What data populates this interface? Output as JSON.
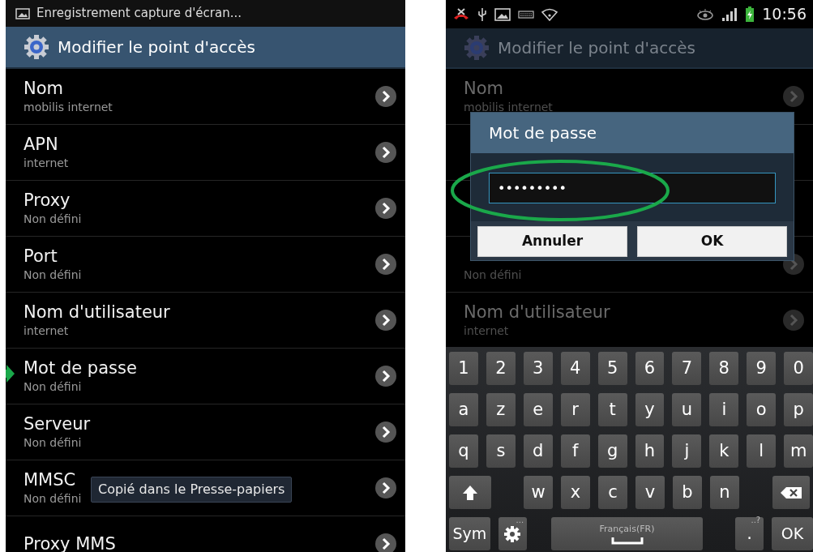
{
  "left_screen": {
    "notification": {
      "text": "Enregistrement capture d'écran..."
    },
    "title": "Modifier le point d'accès",
    "rows": [
      {
        "title": "Nom",
        "subtitle": "mobilis internet"
      },
      {
        "title": "APN",
        "subtitle": "internet"
      },
      {
        "title": "Proxy",
        "subtitle": "Non défini"
      },
      {
        "title": "Port",
        "subtitle": "Non défini"
      },
      {
        "title": "Nom d'utilisateur",
        "subtitle": "internet"
      },
      {
        "title": "Mot de passe",
        "subtitle": "Non défini"
      },
      {
        "title": "Serveur",
        "subtitle": "Non défini"
      },
      {
        "title": "MMSC",
        "subtitle": "Non défini"
      },
      {
        "title": "Proxy MMS"
      }
    ],
    "toast": "Copié dans le Presse-papiers"
  },
  "right_screen": {
    "status_bar": {
      "time": "10:56"
    },
    "title": "Modifier le point d'accès",
    "rows": [
      {
        "kind": "item",
        "title": "Nom",
        "subtitle": "mobilis internet"
      },
      {
        "kind": "covered"
      },
      {
        "kind": "covered"
      },
      {
        "kind": "item",
        "subtitle": "Non défini"
      },
      {
        "kind": "item",
        "title": "Nom d'utilisateur",
        "subtitle": "internet"
      }
    ],
    "dialog": {
      "title": "Mot de passe",
      "value": "•••••••••",
      "buttons": [
        "Annuler",
        "OK"
      ]
    },
    "keyboard": {
      "rows": [
        [
          {
            "kind": "char",
            "label": "1"
          },
          {
            "kind": "char",
            "label": "2"
          },
          {
            "kind": "char",
            "label": "3"
          },
          {
            "kind": "char",
            "label": "4"
          },
          {
            "kind": "char",
            "label": "5"
          },
          {
            "kind": "char",
            "label": "6"
          },
          {
            "kind": "char",
            "label": "7"
          },
          {
            "kind": "char",
            "label": "8"
          },
          {
            "kind": "char",
            "label": "9"
          },
          {
            "kind": "char",
            "label": "0"
          }
        ],
        [
          {
            "kind": "char",
            "label": "a"
          },
          {
            "kind": "char",
            "label": "z"
          },
          {
            "kind": "char",
            "label": "e"
          },
          {
            "kind": "char",
            "label": "r"
          },
          {
            "kind": "char",
            "label": "t"
          },
          {
            "kind": "char",
            "label": "y"
          },
          {
            "kind": "char",
            "label": "u"
          },
          {
            "kind": "char",
            "label": "i"
          },
          {
            "kind": "char",
            "label": "o"
          },
          {
            "kind": "char",
            "label": "p"
          }
        ],
        [
          {
            "kind": "char",
            "label": "q"
          },
          {
            "kind": "char",
            "label": "s"
          },
          {
            "kind": "char",
            "label": "d"
          },
          {
            "kind": "char",
            "label": "f"
          },
          {
            "kind": "char",
            "label": "g"
          },
          {
            "kind": "char",
            "label": "h"
          },
          {
            "kind": "char",
            "label": "j"
          },
          {
            "kind": "char",
            "label": "k"
          },
          {
            "kind": "char",
            "label": "l"
          },
          {
            "kind": "char",
            "label": "m"
          }
        ],
        [
          {
            "kind": "shift"
          },
          "",
          {
            "kind": "char",
            "label": "w"
          },
          {
            "kind": "char",
            "label": "x"
          },
          {
            "kind": "char",
            "label": "c"
          },
          {
            "kind": "char",
            "label": "v"
          },
          {
            "kind": "char",
            "label": "b"
          },
          {
            "kind": "char",
            "label": "n"
          },
          "",
          {
            "kind": "backspace"
          }
        ],
        [
          {
            "kind": "action",
            "label": "Sym"
          },
          {
            "kind": "settings",
            "hint": "..."
          },
          "",
          "",
          {
            "kind": "space",
            "label": "Français(FR)"
          },
          "",
          "",
          "",
          {
            "kind": "char",
            "label": ".",
            "hint": "..?"
          },
          {
            "kind": "action",
            "label": "OK"
          }
        ]
      ]
    }
  }
}
